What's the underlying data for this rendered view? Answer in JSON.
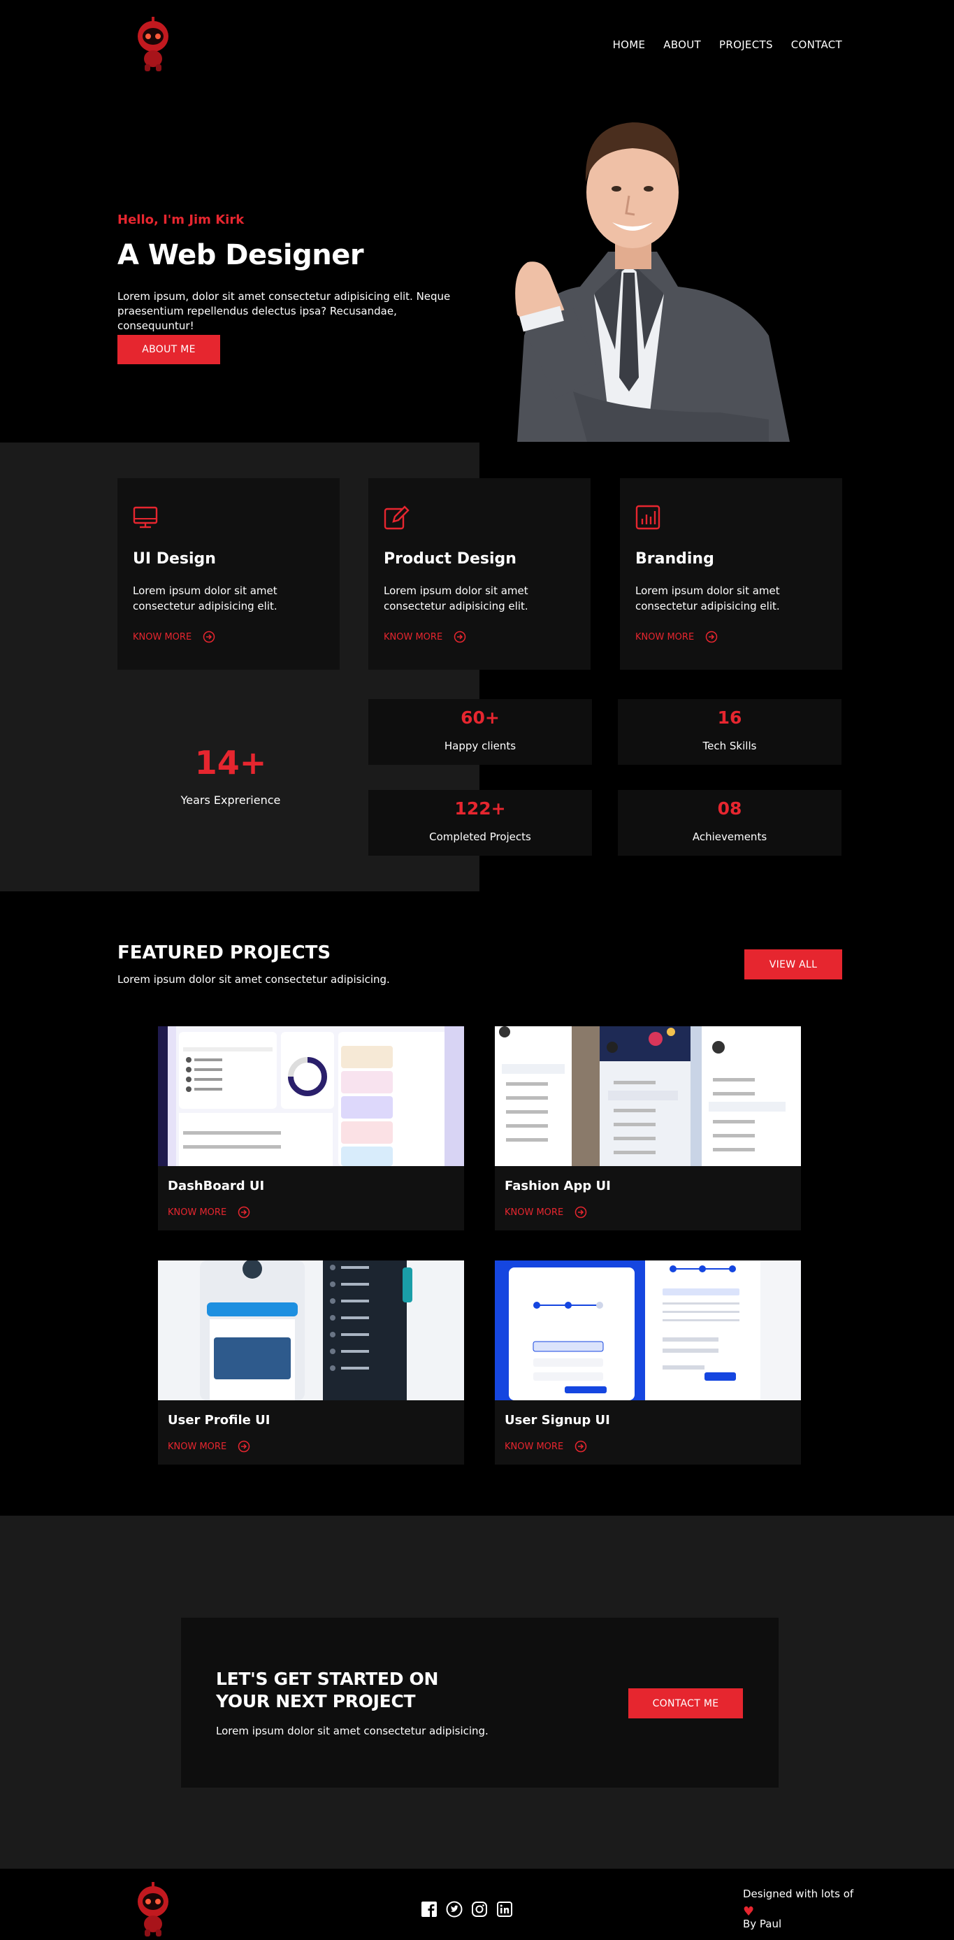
{
  "nav": {
    "items": [
      "HOME",
      "ABOUT",
      "PROJECTS",
      "CONTACT"
    ]
  },
  "hero": {
    "greeting": "Hello, I'm Jim Kirk",
    "title": "A Web Designer",
    "description": "Lorem ipsum, dolor sit amet consectetur adipisicing elit. Neque praesentium repellendus delectus ipsa? Recusandae, consequuntur!",
    "button": "ABOUT ME"
  },
  "services": [
    {
      "title": "UI Design",
      "text": "Lorem ipsum dolor sit amet consectetur adipisicing elit.",
      "link": "KNOW MORE",
      "icon": "monitor-icon"
    },
    {
      "title": "Product Design",
      "text": "Lorem ipsum dolor sit amet consectetur adipisicing elit.",
      "link": "KNOW MORE",
      "icon": "pen-edit-icon"
    },
    {
      "title": "Branding",
      "text": "Lorem ipsum dolor sit amet consectetur adipisicing elit.",
      "link": "KNOW MORE",
      "icon": "bar-chart-icon"
    }
  ],
  "experience": {
    "value": "14+",
    "label": "Years Exprerience"
  },
  "stats": [
    {
      "value": "60+",
      "label": "Happy clients"
    },
    {
      "value": "16",
      "label": "Tech Skills"
    },
    {
      "value": "122+",
      "label": "Completed Projects"
    },
    {
      "value": "08",
      "label": "Achievements"
    }
  ],
  "featured": {
    "title": "FEATURED PROJECTS",
    "subtitle": "Lorem ipsum dolor sit amet consectetur adipisicing.",
    "view_all": "VIEW ALL",
    "projects": [
      {
        "title": "DashBoard UI",
        "link": "KNOW MORE"
      },
      {
        "title": "Fashion App UI",
        "link": "KNOW MORE"
      },
      {
        "title": "User Profile UI",
        "link": "KNOW MORE"
      },
      {
        "title": "User Signup UI",
        "link": "KNOW MORE"
      }
    ]
  },
  "cta": {
    "title": "LET'S GET STARTED ON YOUR NEXT PROJECT",
    "subtitle": "Lorem ipsum dolor sit amet consectetur adipisicing.",
    "button": "CONTACT ME"
  },
  "footer": {
    "socials": [
      "facebook-icon",
      "twitter-icon",
      "instagram-icon",
      "linkedin-icon"
    ],
    "credit_line1": "Designed with lots of",
    "credit_heart": "♥",
    "credit_line2": "By Paul"
  },
  "colors": {
    "accent": "#e6262f",
    "background": "#000000",
    "panel": "#1b1b1b",
    "card": "#101010"
  }
}
